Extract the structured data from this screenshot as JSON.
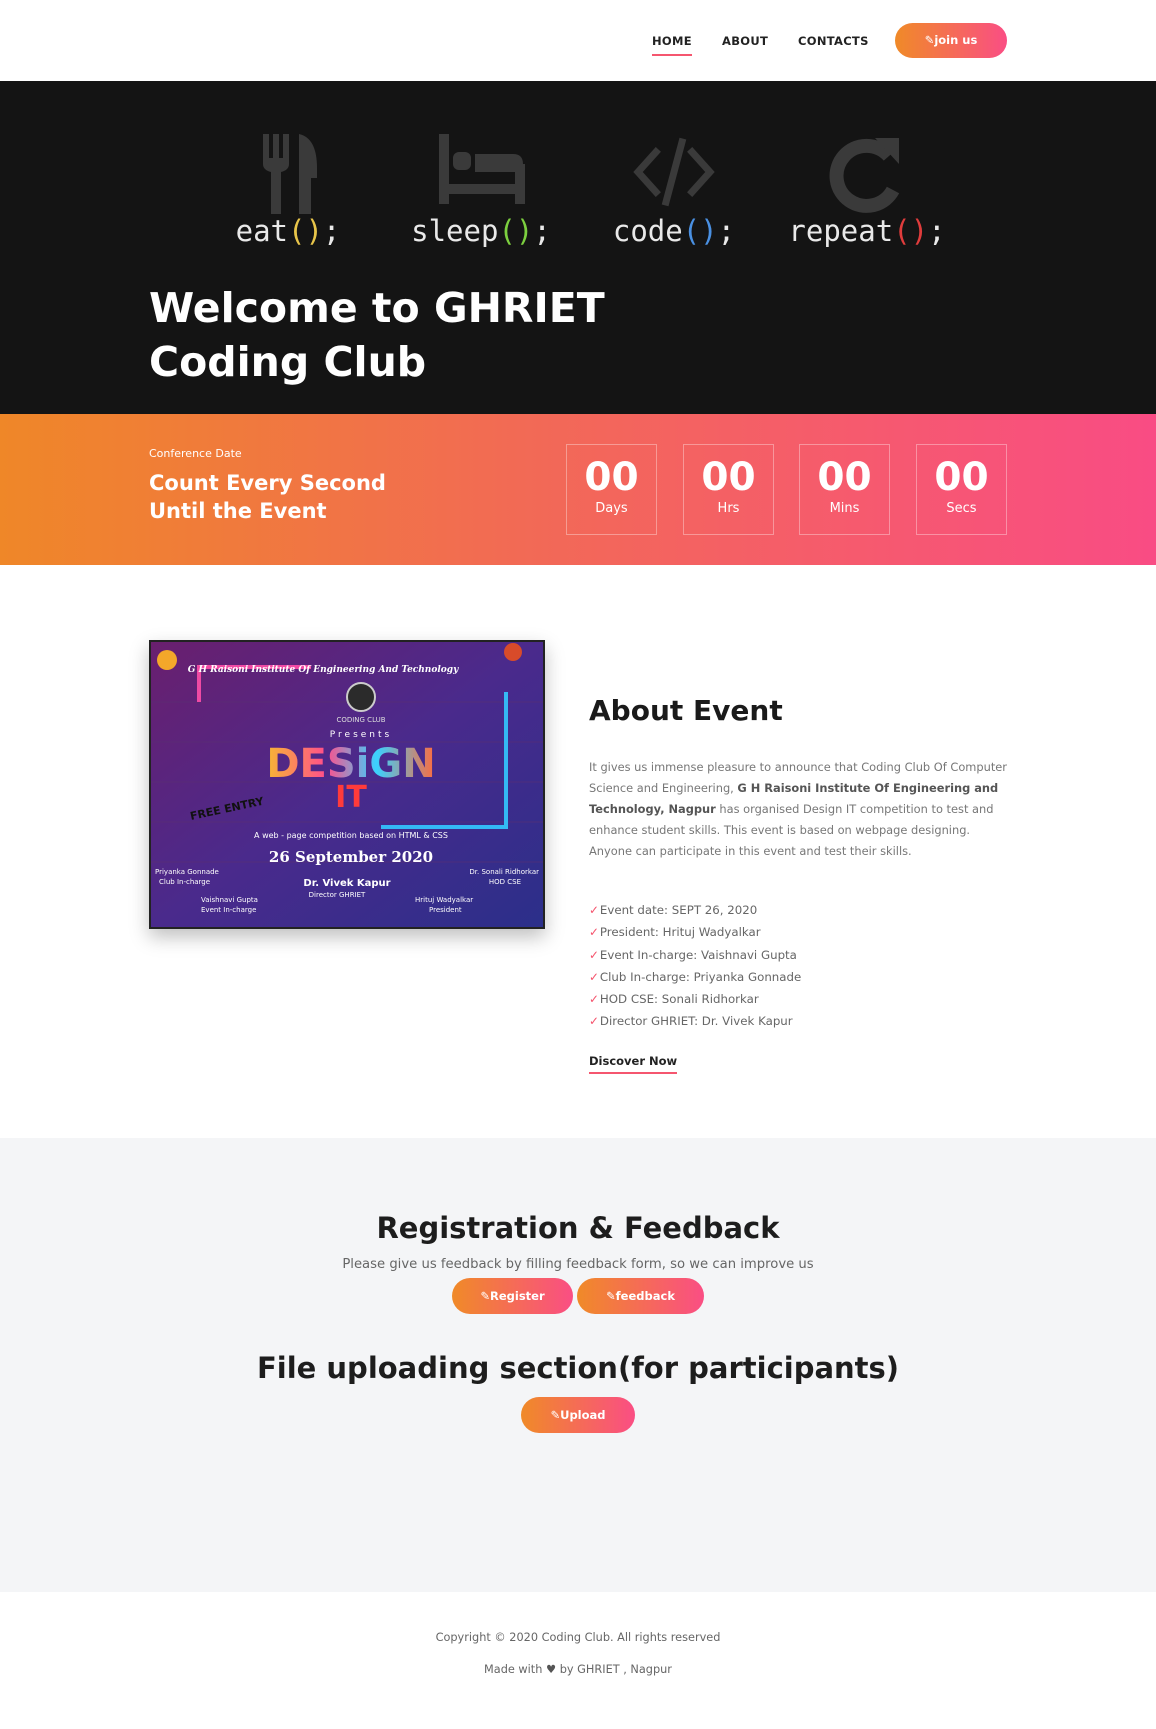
{
  "nav": {
    "home": "HOME",
    "about": "ABOUT",
    "contacts": "CONTACTS",
    "join": "join us"
  },
  "hero": {
    "motto": [
      {
        "icon": "fork-knife-icon",
        "word": "eat",
        "paren_color": "#e8c54a"
      },
      {
        "icon": "bed-icon",
        "word": "sleep",
        "paren_color": "#7ccf3f"
      },
      {
        "icon": "code-icon",
        "word": "code",
        "paren_color": "#4a90e2"
      },
      {
        "icon": "redo-icon",
        "word": "repeat",
        "paren_color": "#e03c3c"
      }
    ],
    "title_line1": "Welcome to GHRIET",
    "title_line2": "Coding Club"
  },
  "countdown": {
    "label": "Conference Date",
    "title_line1": "Count Every Second",
    "title_line2": "Until the Event",
    "units": [
      {
        "value": "00",
        "label": "Days"
      },
      {
        "value": "00",
        "label": "Hrs"
      },
      {
        "value": "00",
        "label": "Mins"
      },
      {
        "value": "00",
        "label": "Secs"
      }
    ]
  },
  "poster": {
    "institute": "G H Raisoni Institute Of Engineering And Technology",
    "club": "CODING CLUB",
    "presents": "Presents",
    "design": "DESiGN",
    "it": "IT",
    "free_entry": "FREE ENTRY",
    "tagline": "A web - page competition based on HTML & CSS",
    "date": "26 September 2020",
    "left_name": "Priyanka Gonnade",
    "left_role": "Club In-charge",
    "right_name": "Dr. Sonali Ridhorkar",
    "right_role": "HOD CSE",
    "center_name": "Dr. Vivek Kapur",
    "center_role": "Director GHRIET",
    "bl_name": "Vaishnavi Gupta",
    "bl_role": "Event In-charge",
    "br_name": "Hrituj Wadyalkar",
    "br_role": "President"
  },
  "about": {
    "title": "About Event",
    "p1": "It gives us immense pleasure to announce that Coding Club Of Computer Science and Engineering, ",
    "p_bold": "G H Raisoni Institute Of Engineering and Technology, Nagpur",
    "p2": " has organised Design IT competition to test and enhance student skills. This event is based on webpage designing. Anyone can participate in this event and test their skills.",
    "check": "✓",
    "items": [
      "Event date: SEPT 26, 2020",
      "President: Hrituj Wadyalkar",
      "Event In-charge: Vaishnavi Gupta",
      "Club In-charge: Priyanka Gonnade",
      "HOD CSE: Sonali Ridhorkar",
      "Director GHRIET: Dr. Vivek Kapur"
    ],
    "discover": "Discover Now"
  },
  "registration": {
    "title": "Registration & Feedback",
    "subtitle": "Please give us feedback by filling feedback form, so we can improve us",
    "register": "Register",
    "feedback": "feedback",
    "file_title": "File uploading section(for participants)",
    "upload": "Upload"
  },
  "footer": {
    "copyright": "Copyright © 2020 Coding Club. All rights reserved",
    "made_prefix": "Made with",
    "heart": "♥",
    "made_suffix": "by GHRIET , Nagpur"
  },
  "colors": {
    "accent_start": "#f08a28",
    "accent_end": "#fa4e84",
    "nav_underline": "#f5566f",
    "hero_bg": "#141414"
  }
}
